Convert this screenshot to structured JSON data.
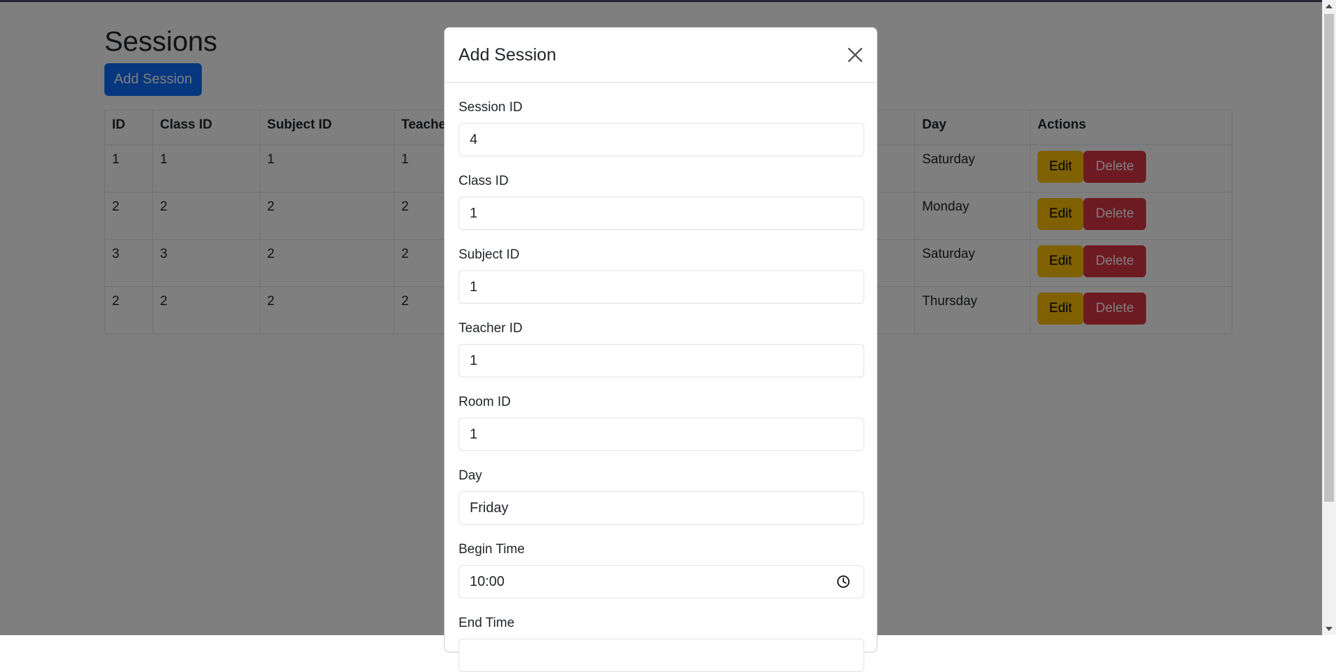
{
  "page": {
    "title": "Sessions",
    "add_button": "Add Session",
    "table": {
      "headers": [
        "ID",
        "Class ID",
        "Subject ID",
        "Teache",
        "Day",
        "Actions"
      ],
      "rows": [
        {
          "id": "1",
          "class_id": "1",
          "subject_id": "1",
          "teacher": "1",
          "day": "Saturday"
        },
        {
          "id": "2",
          "class_id": "2",
          "subject_id": "2",
          "teacher": "2",
          "day": "Monday"
        },
        {
          "id": "3",
          "class_id": "3",
          "subject_id": "2",
          "teacher": "2",
          "day": "Saturday"
        },
        {
          "id": "2",
          "class_id": "2",
          "subject_id": "2",
          "teacher": "2",
          "day": "Thursday"
        }
      ],
      "edit_label": "Edit",
      "delete_label": "Delete"
    }
  },
  "modal": {
    "title": "Add Session",
    "fields": [
      {
        "label": "Session ID",
        "value": "4"
      },
      {
        "label": "Class ID",
        "value": "1"
      },
      {
        "label": "Subject ID",
        "value": "1"
      },
      {
        "label": "Teacher ID",
        "value": "1"
      },
      {
        "label": "Room ID",
        "value": "1"
      },
      {
        "label": "Day",
        "value": "Friday"
      },
      {
        "label": "Begin Time",
        "value": "10:00"
      },
      {
        "label": "End Time",
        "value": ""
      }
    ]
  },
  "colors": {
    "primary": "#0d6efd",
    "warning": "#ffc107",
    "danger": "#dc3545"
  },
  "icons": {
    "close": "close-icon",
    "clock": "clock-icon"
  }
}
